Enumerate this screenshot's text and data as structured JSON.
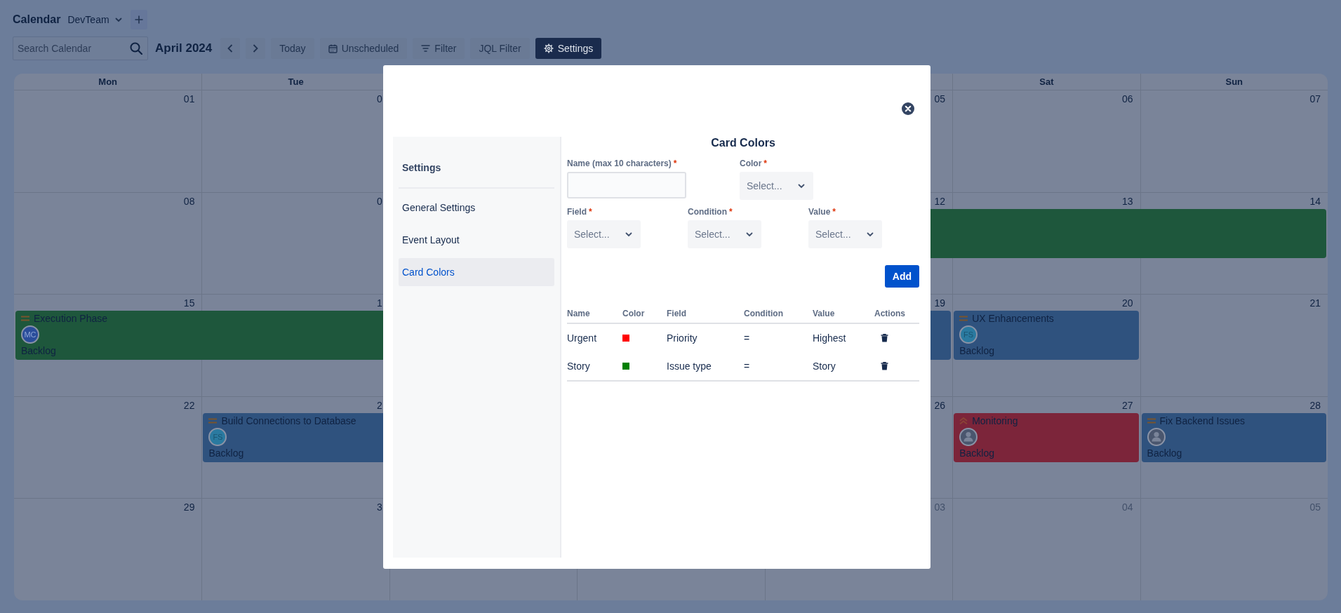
{
  "toolbar": {
    "title": "Calendar",
    "project": "DevTeam",
    "search": {
      "placeholder": "Search Calendar"
    },
    "month": "April 2024",
    "buttons": [
      {
        "kind": "previous",
        "selected": false
      },
      {
        "kind": "next",
        "selected": false
      },
      {
        "kind": "plain",
        "label": "Today",
        "selected": false
      },
      {
        "kind": "calendar",
        "label": "Unscheduled",
        "selected": false
      },
      {
        "kind": "filter",
        "label": "Filter",
        "selected": false
      },
      {
        "kind": "plain",
        "label": "JQL Filter",
        "selected": false
      },
      {
        "kind": "gear",
        "label": "Settings",
        "selected": true
      }
    ]
  },
  "calendar": {
    "weekdays_left": [
      "Mon",
      "Tue"
    ],
    "weekdays_right": [
      "Sat",
      "Sun"
    ],
    "weeks": [
      {
        "days_left": [
          {
            "date": "01",
            "muted": false
          },
          {
            "date": "0",
            "muted": false
          }
        ],
        "days_right": [
          {
            "date": "05",
            "muted": false
          },
          {
            "date": "06",
            "muted": false
          },
          {
            "date": "07",
            "muted": false
          }
        ]
      },
      {
        "days_left": [
          {
            "date": "08",
            "muted": false
          },
          {
            "date": "0",
            "muted": false
          }
        ],
        "days_right": [
          {
            "date": "12",
            "muted": false,
            "event": {
              "kind": "plain",
              "color": "#1e573c"
            }
          },
          {
            "date": "13",
            "muted": false,
            "covered": true
          },
          {
            "date": "14",
            "muted": false,
            "covered": true
          }
        ]
      },
      {
        "days_left": [
          {
            "date": "15",
            "muted": false,
            "event": {
              "kind": "medium",
              "title": "Execution Phase",
              "avatar": {
                "kind": "initials",
                "initials": "MC"
              },
              "status": "Backlog",
              "color": "#1e573c"
            }
          },
          {
            "date": "1",
            "muted": false,
            "covered": true
          }
        ],
        "days_right": [
          {
            "date": "19",
            "muted": false,
            "event": {
              "kind": "plain",
              "color": "#2f527e"
            }
          },
          {
            "date": "20",
            "muted": false,
            "event": {
              "kind": "medium",
              "title": "UX Enhancements",
              "avatar": {
                "kind": "initials",
                "initials": "FS"
              },
              "status": "Backlog",
              "color": "#2f527e"
            }
          },
          {
            "date": "21",
            "muted": false
          }
        ]
      },
      {
        "days_left": [
          {
            "date": "22",
            "muted": false
          },
          {
            "date": "2",
            "muted": false,
            "event": {
              "kind": "medium",
              "title": "Build Connections to Database",
              "avatar": {
                "kind": "initials",
                "initials": "FS"
              },
              "status": "Backlog",
              "color": "#2f527e"
            }
          }
        ],
        "days_right": [
          {
            "date": "26",
            "muted": false
          },
          {
            "date": "27",
            "muted": false,
            "event": {
              "kind": "high",
              "title": "Monitoring",
              "avatar": {
                "kind": "person"
              },
              "status": "Backlog",
              "color": "#7c253a"
            }
          },
          {
            "date": "28",
            "muted": false,
            "event": {
              "kind": "medium",
              "title": "Fix Backend Issues",
              "avatar": {
                "kind": "person"
              },
              "status": "Backlog",
              "color": "#2f527e"
            }
          }
        ]
      },
      {
        "days_left": [
          {
            "date": "29",
            "muted": false
          },
          {
            "date": "3",
            "muted": false
          }
        ],
        "days_right": [
          {
            "date": "03",
            "muted": true
          },
          {
            "date": "04",
            "muted": true
          },
          {
            "date": "05",
            "muted": true
          }
        ]
      }
    ]
  },
  "modal": {
    "sidebar": {
      "title": "Settings",
      "items": [
        {
          "label": "General Settings",
          "selected": false
        },
        {
          "label": "Event Layout",
          "selected": false
        },
        {
          "label": "Card Colors",
          "selected": true
        }
      ]
    },
    "panel": {
      "title": "Card Colors",
      "form_rows": [
        [
          {
            "kind": "text",
            "label": "Name (max 10 characters)",
            "required_mark": "*"
          },
          {
            "kind": "select",
            "label": "Color",
            "required_mark": "*",
            "placeholder": "Select..."
          }
        ],
        [
          {
            "kind": "select",
            "label": "Field",
            "required_mark": "*",
            "placeholder": "Select..."
          },
          {
            "kind": "select",
            "label": "Condition",
            "required_mark": "*",
            "placeholder": "Select..."
          },
          {
            "kind": "select",
            "label": "Value",
            "required_mark": "*",
            "placeholder": "Select..."
          }
        ]
      ],
      "add_button": "Add",
      "table": {
        "columns": [
          "Name",
          "Color",
          "Field",
          "Condition",
          "Value",
          "Actions"
        ],
        "rows": [
          {
            "name": "Urgent",
            "color": "#ff0000",
            "field": "Priority",
            "condition": "=",
            "value": "Highest"
          },
          {
            "name": "Story",
            "color": "#008000",
            "field": "Issue type",
            "condition": "=",
            "value": "Story"
          }
        ]
      }
    }
  }
}
